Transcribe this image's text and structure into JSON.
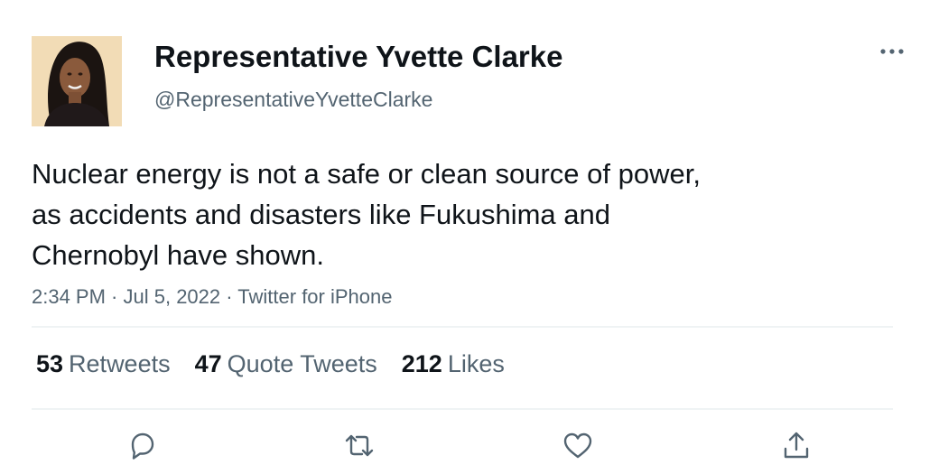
{
  "author": {
    "display_name": "Representative Yvette Clarke",
    "handle": "@RepresentativeYvetteClarke"
  },
  "tweet": {
    "lines": [
      "Nuclear energy is not a safe or clean source of power,",
      "as accidents and disasters like Fukushima and",
      "Chernobyl have shown."
    ],
    "time": "2:34 PM",
    "date": "Jul 5, 2022",
    "source": "Twitter for iPhone",
    "separator": " · "
  },
  "stats": {
    "retweets": {
      "count": "53",
      "label": "Retweets"
    },
    "quote_tweets": {
      "count": "47",
      "label": "Quote Tweets"
    },
    "likes": {
      "count": "212",
      "label": "Likes"
    }
  },
  "actions": [
    {
      "name": "reply",
      "icon": "reply-icon"
    },
    {
      "name": "retweet",
      "icon": "retweet-icon"
    },
    {
      "name": "like",
      "icon": "heart-icon"
    },
    {
      "name": "share",
      "icon": "share-icon"
    }
  ],
  "colors": {
    "text_primary": "#0f1419",
    "text_secondary": "#536471",
    "divider": "#eff3f4",
    "icon": "#536471"
  }
}
